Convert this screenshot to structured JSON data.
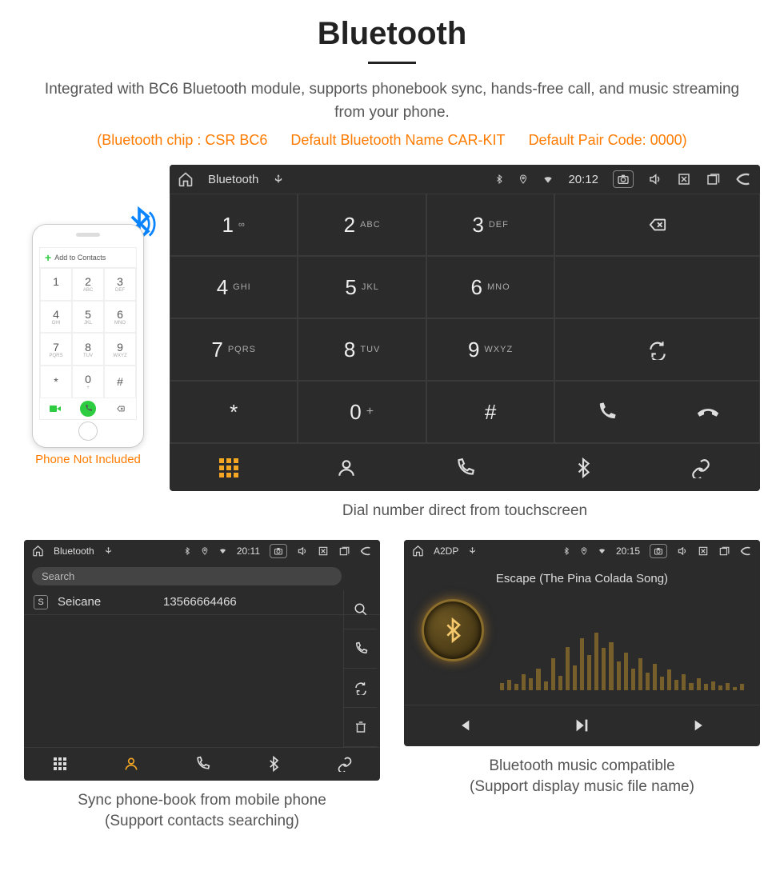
{
  "header": {
    "title": "Bluetooth",
    "subtitle": "Integrated with BC6 Bluetooth module, supports phonebook sync, hands-free call, and music streaming from your phone.",
    "spec_chip": "(Bluetooth chip : CSR BC6",
    "spec_name": "Default Bluetooth Name CAR-KIT",
    "spec_code": "Default Pair Code: 0000)"
  },
  "phone_mock": {
    "add_contacts": "Add to Contacts",
    "keys": [
      "1",
      "2",
      "3",
      "4",
      "5",
      "6",
      "7",
      "8",
      "9",
      "*",
      "0",
      "#"
    ],
    "caption": "Phone Not Included"
  },
  "dialer": {
    "status": {
      "title": "Bluetooth",
      "time": "20:12"
    },
    "keys": [
      {
        "d": "1",
        "s": "∞"
      },
      {
        "d": "2",
        "s": "ABC"
      },
      {
        "d": "3",
        "s": "DEF"
      },
      {
        "d": "4",
        "s": "GHI"
      },
      {
        "d": "5",
        "s": "JKL"
      },
      {
        "d": "6",
        "s": "MNO"
      },
      {
        "d": "7",
        "s": "PQRS"
      },
      {
        "d": "8",
        "s": "TUV"
      },
      {
        "d": "9",
        "s": "WXYZ"
      },
      {
        "d": "*",
        "s": ""
      },
      {
        "d": "0",
        "s": "+"
      },
      {
        "d": "#",
        "s": ""
      }
    ],
    "caption": "Dial number direct from touchscreen"
  },
  "contacts": {
    "status": {
      "title": "Bluetooth",
      "time": "20:11"
    },
    "search_placeholder": "Search",
    "rows": [
      {
        "letter": "S",
        "name": "Seicane",
        "number": "13566664466"
      }
    ],
    "caption_l1": "Sync phone-book from mobile phone",
    "caption_l2": "(Support contacts searching)"
  },
  "a2dp": {
    "status": {
      "title": "A2DP",
      "time": "20:15"
    },
    "song": "Escape (The Pina Colada Song)",
    "caption_l1": "Bluetooth music compatible",
    "caption_l2": "(Support display music file name)"
  }
}
